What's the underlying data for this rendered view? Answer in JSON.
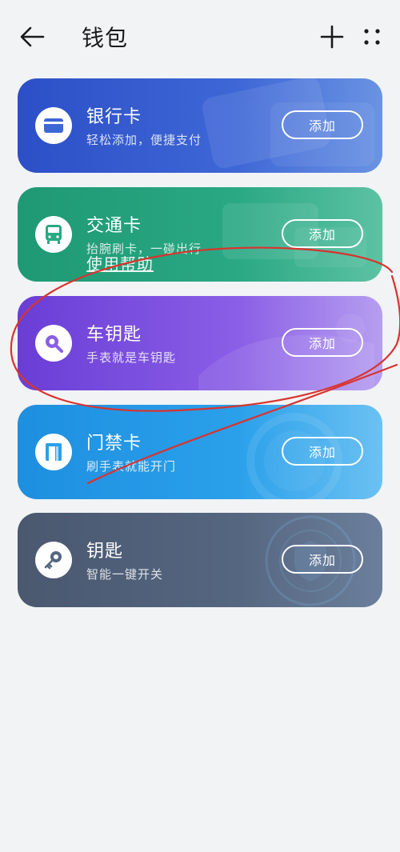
{
  "header": {
    "title": "钱包",
    "back_icon": "arrow-left-icon",
    "add_icon": "plus-icon",
    "more_icon": "more-dots-icon"
  },
  "cards": [
    {
      "id": "bank",
      "title": "银行卡",
      "subtitle": "轻松添加，便捷支付",
      "button": "添加",
      "icon": "card-icon",
      "color": "#3e67d6"
    },
    {
      "id": "transit",
      "title": "交通卡",
      "subtitle": "抬腕刷卡，一碰出行",
      "button": "添加",
      "icon": "bus-icon",
      "color": "#2aa884",
      "help_link": "使用帮助"
    },
    {
      "id": "carkey",
      "title": "车钥匙",
      "subtitle": "手表就是车钥匙",
      "button": "添加",
      "icon": "car-key-icon",
      "color": "#8a5ee6"
    },
    {
      "id": "door",
      "title": "门禁卡",
      "subtitle": "刷手表就能开门",
      "button": "添加",
      "icon": "door-icon",
      "color": "#2aa0ea"
    },
    {
      "id": "key",
      "title": "钥匙",
      "subtitle": "智能一键开关",
      "button": "添加",
      "icon": "key-icon",
      "color": "#556680"
    }
  ],
  "annotation_color": "#d9332e"
}
